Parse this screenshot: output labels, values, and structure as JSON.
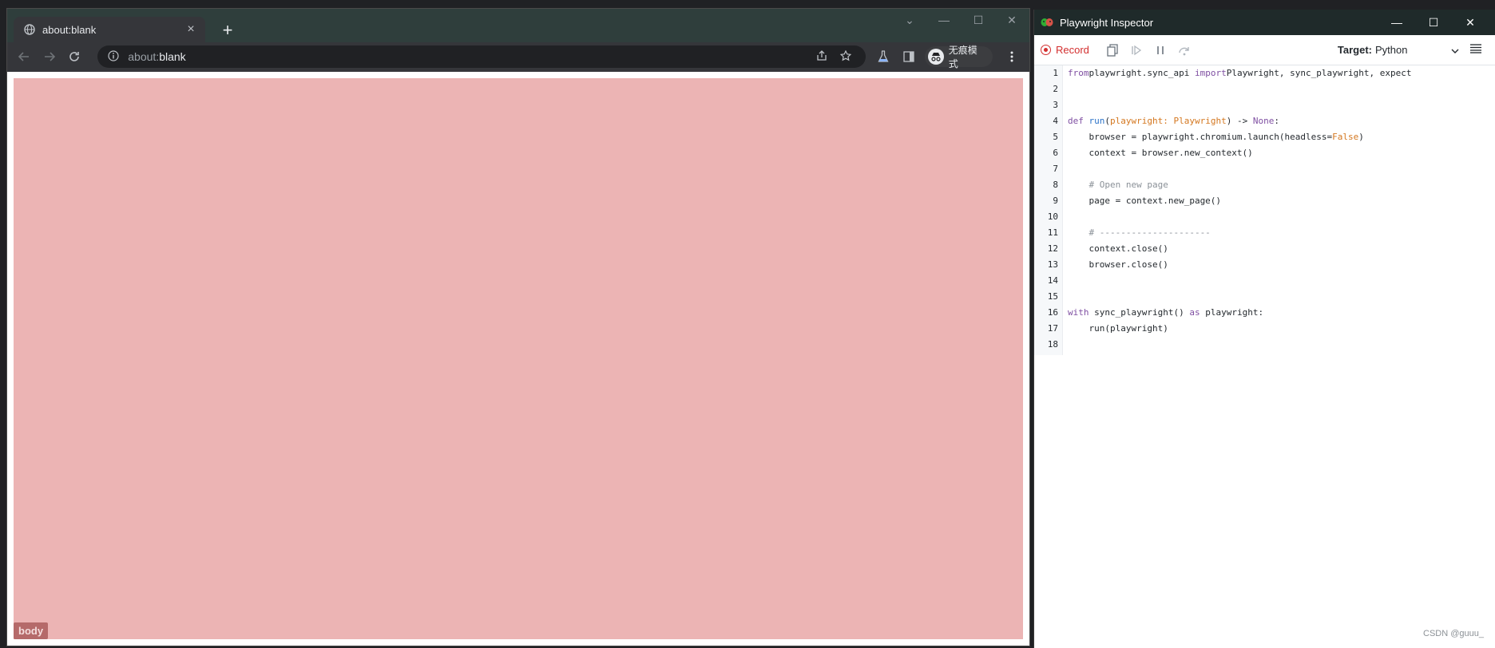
{
  "browser": {
    "tab": {
      "title": "about:blank",
      "close": "×"
    },
    "new_tab": "+",
    "window_controls": {
      "minimize": "—",
      "maximize": "☐",
      "close": "✕",
      "tabsearch": "⌄"
    },
    "omnibox": {
      "host": "about:",
      "path": "blank",
      "info_icon": "info-icon"
    },
    "incognito_label": "无痕模式",
    "page": {
      "element_tag": "body",
      "highlight_color": "#ecb4b4"
    }
  },
  "inspector": {
    "title": "Playwright Inspector",
    "window_controls": {
      "minimize": "—",
      "maximize": "☐",
      "close": "✕"
    },
    "toolbar": {
      "record_label": "Record",
      "target_label": "Target:",
      "target_value": "Python"
    },
    "code_lines": [
      {
        "n": "1",
        "parts": [
          [
            "kw",
            "from"
          ],
          [
            "",
            "playwright.sync_api "
          ],
          [
            "kw",
            "import"
          ],
          [
            "",
            ""
          ],
          [
            "",
            "Playwright, sync_playwright, expect"
          ]
        ]
      },
      {
        "n": "2",
        "parts": []
      },
      {
        "n": "3",
        "parts": []
      },
      {
        "n": "4",
        "parts": [
          [
            "kw",
            "def "
          ],
          [
            "fn",
            "run"
          ],
          [
            "",
            "("
          ],
          [
            "par",
            "playwright: Playwright"
          ],
          [
            "",
            ") -> "
          ],
          [
            "kw",
            "None"
          ],
          [
            "",
            ":"
          ]
        ]
      },
      {
        "n": "5",
        "parts": [
          [
            "",
            "    browser = playwright.chromium.launch(headless="
          ],
          [
            "par",
            "False"
          ],
          [
            "",
            ")"
          ]
        ]
      },
      {
        "n": "6",
        "parts": [
          [
            "",
            "    context = browser.new_context()"
          ]
        ]
      },
      {
        "n": "7",
        "parts": []
      },
      {
        "n": "8",
        "parts": [
          [
            "cm",
            "    # Open new page"
          ]
        ]
      },
      {
        "n": "9",
        "parts": [
          [
            "",
            "    page = context.new_page()"
          ]
        ]
      },
      {
        "n": "10",
        "parts": []
      },
      {
        "n": "11",
        "parts": [
          [
            "cm",
            "    # ---------------------"
          ]
        ]
      },
      {
        "n": "12",
        "parts": [
          [
            "",
            "    context.close()"
          ]
        ]
      },
      {
        "n": "13",
        "parts": [
          [
            "",
            "    browser.close()"
          ]
        ]
      },
      {
        "n": "14",
        "parts": []
      },
      {
        "n": "15",
        "parts": []
      },
      {
        "n": "16",
        "parts": [
          [
            "kw",
            "with"
          ],
          [
            "",
            " sync_playwright() "
          ],
          [
            "kw",
            "as"
          ],
          [
            "",
            " playwright:"
          ]
        ]
      },
      {
        "n": "17",
        "parts": [
          [
            "",
            "    run(playwright)"
          ]
        ]
      },
      {
        "n": "18",
        "parts": []
      }
    ],
    "watermark": "CSDN @guuu_"
  }
}
